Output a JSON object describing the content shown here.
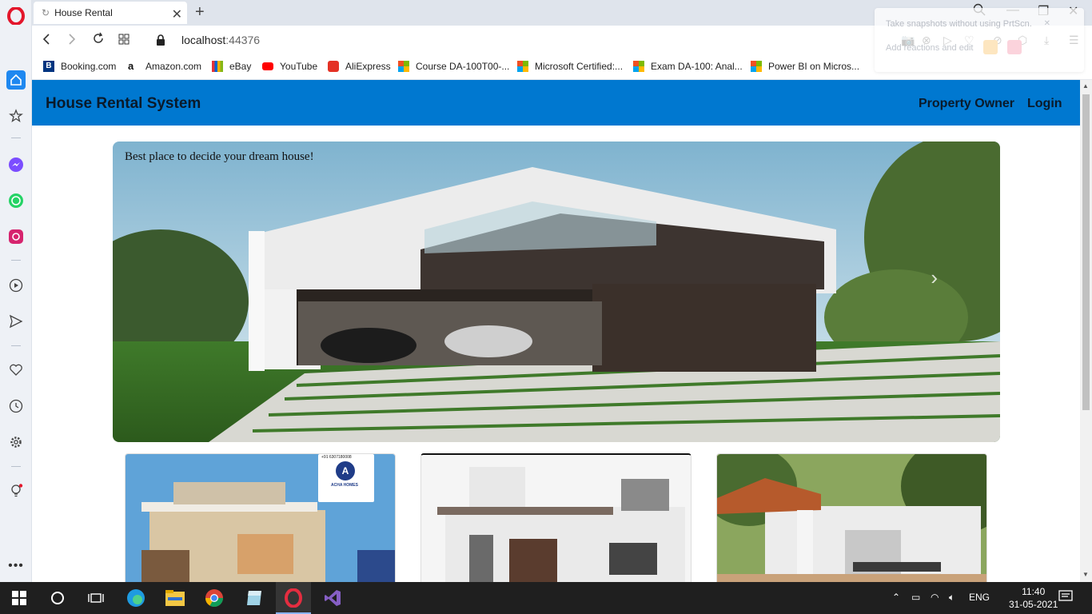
{
  "browser": {
    "tab_title": "House Rental",
    "url_host": "localhost",
    "url_port": ":44376",
    "bookmarks": [
      {
        "label": "Booking.com",
        "icon": "booking-icon"
      },
      {
        "label": "Amazon.com",
        "icon": "amazon-icon"
      },
      {
        "label": "eBay",
        "icon": "ebay-icon"
      },
      {
        "label": "YouTube",
        "icon": "youtube-icon"
      },
      {
        "label": "AliExpress",
        "icon": "aliexpress-icon"
      },
      {
        "label": "Course DA-100T00-...",
        "icon": "microsoft-icon"
      },
      {
        "label": "Microsoft Certified:...",
        "icon": "microsoft-icon"
      },
      {
        "label": "Exam DA-100: Anal...",
        "icon": "microsoft-icon"
      },
      {
        "label": "Power BI on Micros...",
        "icon": "microsoft-icon"
      }
    ],
    "popup": {
      "line1": "Take snapshots without using PrtScn.",
      "line2": "Add reactions and edit"
    }
  },
  "site": {
    "brand": "House Rental System",
    "nav": {
      "property_owner": "Property Owner",
      "login": "Login"
    },
    "hero_caption": "Best place to decide your dream house!",
    "card1_badge_phone": "+91 6307180008",
    "card1_badge_name": "ACHA HOMES"
  },
  "taskbar": {
    "language": "ENG",
    "time": "11:40",
    "date": "31-05-2021"
  },
  "colors": {
    "navbar": "#0078d0",
    "taskbar": "#1f1f1f",
    "opera_red": "#e3162b"
  }
}
